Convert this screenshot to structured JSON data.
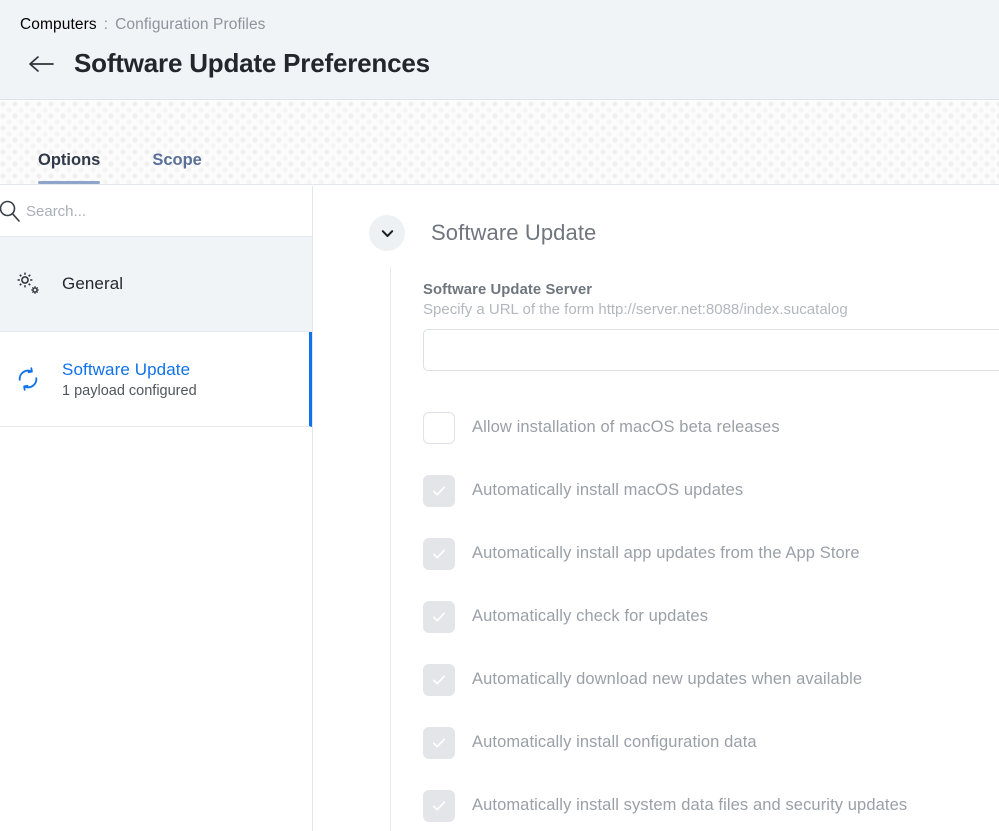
{
  "header": {
    "breadcrumb": {
      "root": "Computers",
      "separator": ":",
      "leaf": "Configuration Profiles"
    },
    "back_icon": "arrow-left-icon",
    "title": "Software Update Preferences"
  },
  "tabs": [
    {
      "label": "Options",
      "active": true
    },
    {
      "label": "Scope",
      "active": false
    }
  ],
  "sidebar": {
    "search": {
      "placeholder": "Search...",
      "value": "",
      "icon": "search-icon"
    },
    "items": [
      {
        "name": "General",
        "sub": "",
        "icon": "gears-icon",
        "selected": false
      },
      {
        "name": "Software Update",
        "sub": "1 payload configured",
        "icon": "sync-icon",
        "selected": true
      }
    ]
  },
  "main": {
    "collapse_icon": "chevron-down-icon",
    "section_title": "Software Update",
    "field": {
      "label": "Software Update Server",
      "hint": "Specify a URL of the form http://server.net:8088/index.sucatalog",
      "value": "",
      "placeholder": ""
    },
    "checkboxes": [
      {
        "label": "Allow installation of macOS beta releases",
        "checked": false
      },
      {
        "label": "Automatically install macOS updates",
        "checked": true
      },
      {
        "label": "Automatically install app updates from the App Store",
        "checked": true
      },
      {
        "label": "Automatically check for updates",
        "checked": true
      },
      {
        "label": "Automatically download new updates when available",
        "checked": true
      },
      {
        "label": "Automatically install configuration data",
        "checked": true
      },
      {
        "label": "Automatically install system data files and security updates",
        "checked": true
      }
    ]
  },
  "colors": {
    "accent_blue": "#1072eb",
    "header_bg": "#f1f4f7",
    "tab_active_underline": "#8fa4c8",
    "tab_inactive_text": "#5b7099"
  }
}
